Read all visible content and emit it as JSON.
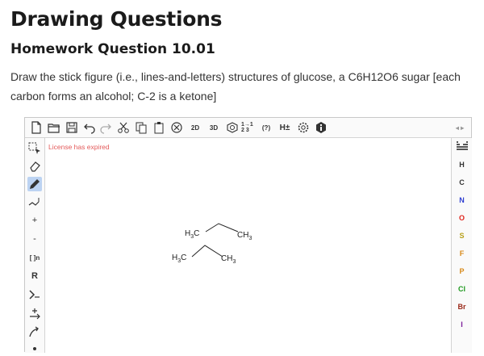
{
  "page": {
    "title": "Drawing Questions",
    "question_title": "Homework Question 10.01",
    "question_text": "Draw the stick figure (i.e., lines-and-letters) structures of glucose, a C6H12O6 sugar [each carbon forms an alcohol; C-2 is a ketone]"
  },
  "editor": {
    "license_message": "License has expired",
    "toolbar": {
      "label_2d": "2D",
      "label_3d": "3D",
      "label_hplus": "H±",
      "label_fraction": "1→1 2 3",
      "label_abbrev": "(?)",
      "label_zoom": "◂ ▸"
    },
    "left_tools": {
      "plus": "+",
      "minus": "-",
      "r_group": "R",
      "sgroup": "[ ]n"
    },
    "atoms": [
      {
        "symbol": "H",
        "color": "#333333"
      },
      {
        "symbol": "C",
        "color": "#333333"
      },
      {
        "symbol": "N",
        "color": "#2f3fd0"
      },
      {
        "symbol": "O",
        "color": "#e0261e"
      },
      {
        "symbol": "S",
        "color": "#b8a01a"
      },
      {
        "symbol": "F",
        "color": "#d88a1a"
      },
      {
        "symbol": "P",
        "color": "#d88a1a"
      },
      {
        "symbol": "Cl",
        "color": "#1f9a1f"
      },
      {
        "symbol": "Br",
        "color": "#9a2a1a"
      },
      {
        "symbol": "I",
        "color": "#7a1a9a"
      }
    ],
    "periodic_table_label": "periodic-table",
    "molecule1": {
      "left": "H3C",
      "right": "CH3"
    },
    "molecule2": {
      "left": "H3C",
      "right": "CH3"
    }
  }
}
